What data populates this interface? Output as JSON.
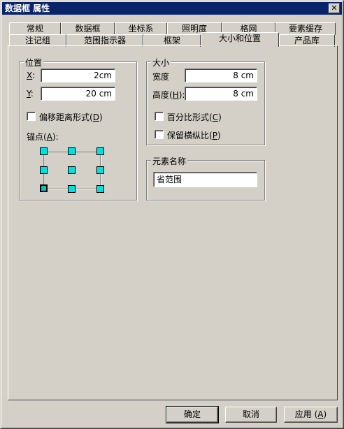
{
  "window": {
    "title": "数据框 属性",
    "close_glyph": "✕"
  },
  "tabs_row1": [
    "常规",
    "数据框",
    "坐标系",
    "照明度",
    "格网",
    "要素缓存"
  ],
  "tabs_row2": [
    "注记组",
    "范围指示器",
    "框架",
    "大小和位置",
    "产品库"
  ],
  "active_tab": "大小和位置",
  "position": {
    "title": "位置",
    "x_label": "X",
    "x_suffix": ":",
    "x_value": "2cm",
    "y_label": "Y",
    "y_suffix": ":",
    "y_value": "20 cm",
    "offset_label": "偏移距离形式(",
    "offset_key": "D",
    "offset_close": ")",
    "anchor_label": "锚点(",
    "anchor_key": "A",
    "anchor_close": "):"
  },
  "size": {
    "title": "大小",
    "width_label": "宽度",
    "width_value": "8 cm",
    "height_label": "高度(",
    "height_key": "H",
    "height_close": "):",
    "height_value": "8 cm",
    "percent_label": "百分比形式(",
    "percent_key": "C",
    "percent_close": ")",
    "keep_ratio_label": "保留横纵比(",
    "keep_ratio_key": "P",
    "keep_ratio_close": ")"
  },
  "element_name": {
    "title": "元素名称",
    "value": "省范围"
  },
  "buttons": {
    "ok": "确定",
    "cancel": "取消",
    "apply": "应用 (",
    "apply_key": "A",
    "apply_close": ")"
  }
}
